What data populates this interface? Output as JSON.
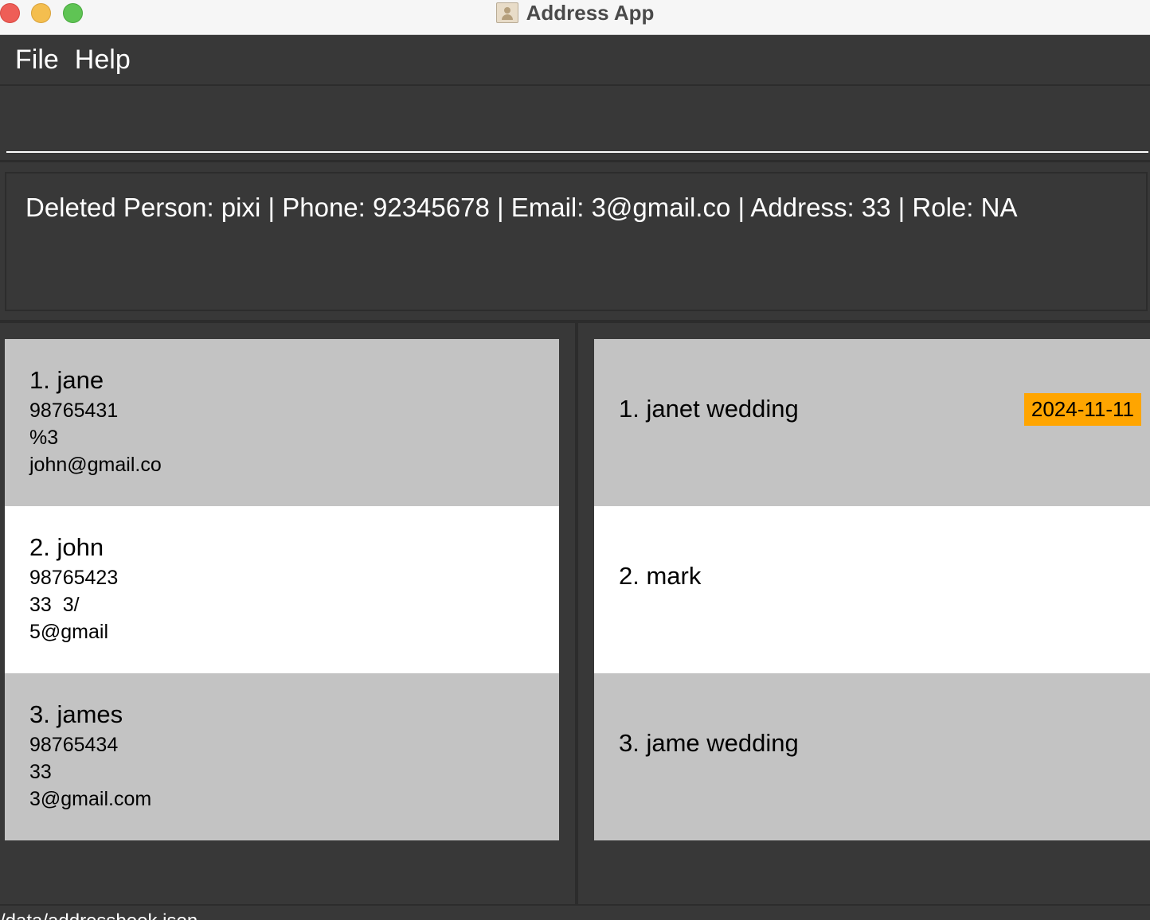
{
  "window": {
    "title": "Address App"
  },
  "menu": {
    "items": [
      "File",
      "Help"
    ]
  },
  "command": {
    "value": ""
  },
  "result": {
    "text": "Deleted Person: pixi | Phone: 92345678 | Email: 3@gmail.co | Address: 33 | Role: NA"
  },
  "persons": [
    {
      "name": "1. jane",
      "phone": "98765431",
      "address": "%3",
      "email": "john@gmail.co"
    },
    {
      "name": "2. john",
      "phone": "98765423",
      "address": "33  3/",
      "email": "5@gmail"
    },
    {
      "name": "3. james",
      "phone": "98765434",
      "address": "33",
      "email": "3@gmail.com"
    }
  ],
  "events": [
    {
      "name": "1. janet wedding",
      "date": "2024-11-11"
    },
    {
      "name": "2. mark",
      "date": ""
    },
    {
      "name": "3. jame wedding",
      "date": ""
    }
  ],
  "status": {
    "path": "/data/addressbook.json"
  },
  "colors": {
    "background": "#383838",
    "card_grey": "#c3c3c3",
    "card_white": "#ffffff",
    "date_badge": "#ffa500"
  }
}
